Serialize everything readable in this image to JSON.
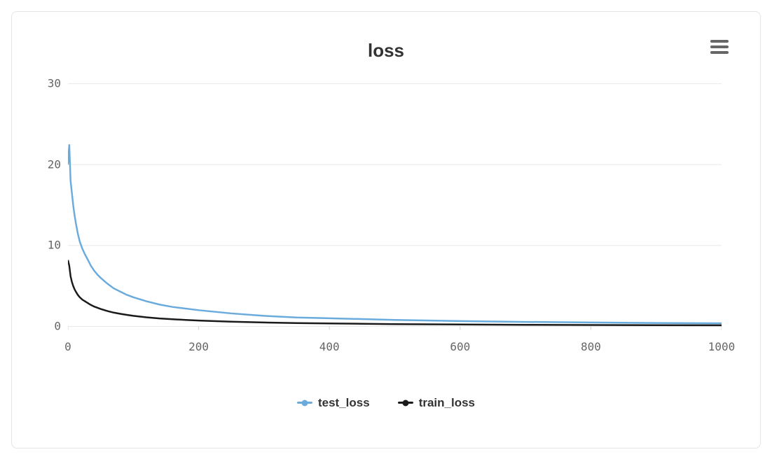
{
  "chart_data": {
    "type": "line",
    "title": "loss",
    "xlabel": "",
    "ylabel": "",
    "xlim": [
      0,
      1000
    ],
    "ylim": [
      -1,
      31
    ],
    "x_ticks": [
      0,
      200,
      400,
      600,
      800,
      1000
    ],
    "y_ticks": [
      0,
      10,
      20,
      30
    ],
    "x": [
      0,
      2,
      4,
      6,
      8,
      10,
      12,
      15,
      18,
      22,
      26,
      30,
      35,
      40,
      45,
      50,
      60,
      70,
      80,
      90,
      100,
      120,
      140,
      160,
      180,
      200,
      250,
      300,
      350,
      400,
      450,
      500,
      600,
      700,
      800,
      900,
      1000
    ],
    "series": [
      {
        "name": "test_loss",
        "color": "#6aabde",
        "values": [
          20.0,
          22.5,
          18.0,
          16.5,
          15.0,
          13.8,
          12.8,
          11.5,
          10.5,
          9.6,
          8.9,
          8.3,
          7.5,
          6.9,
          6.4,
          6.0,
          5.3,
          4.7,
          4.3,
          3.9,
          3.6,
          3.1,
          2.7,
          2.4,
          2.2,
          2.0,
          1.6,
          1.3,
          1.1,
          1.0,
          0.9,
          0.8,
          0.65,
          0.55,
          0.48,
          0.42,
          0.38
        ]
      },
      {
        "name": "train_loss",
        "color": "#1a1a1a",
        "values": [
          8.2,
          7.5,
          6.2,
          5.5,
          5.0,
          4.6,
          4.3,
          3.9,
          3.6,
          3.3,
          3.1,
          2.9,
          2.65,
          2.45,
          2.3,
          2.15,
          1.9,
          1.7,
          1.55,
          1.42,
          1.3,
          1.12,
          0.98,
          0.88,
          0.8,
          0.72,
          0.58,
          0.48,
          0.41,
          0.36,
          0.32,
          0.28,
          0.23,
          0.19,
          0.17,
          0.15,
          0.13
        ]
      }
    ]
  },
  "legend": {
    "items": [
      {
        "label": "test_loss",
        "color": "#6aabde"
      },
      {
        "label": "train_loss",
        "color": "#1a1a1a"
      }
    ]
  },
  "menu_icon": "hamburger-menu"
}
